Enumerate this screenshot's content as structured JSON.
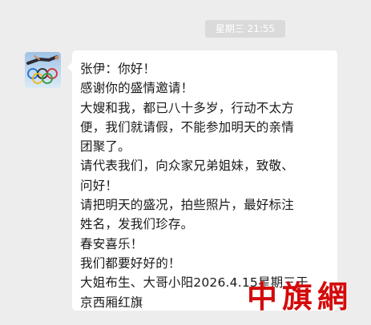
{
  "chat": {
    "timestamp": "星期三 21:55",
    "avatar_icon": "athlete-diving-over-olympic-rings-icon",
    "message": {
      "lines": [
        "张伊：你好！",
        "感谢你的盛情邀请！",
        "大嫂和我，都已八十多岁，行动不太方",
        "便，我们就请假，不能参加明天的亲情",
        "团聚了。",
        "请代表我们，向众家兄弟姐妹，致敬、",
        "问好！",
        "请把明天的盛况，拍些照片，最好标注",
        "姓名，发我们珍存。",
        "春安喜乐！",
        "我们都要好好的！",
        "大姐布生、大哥小阳2026.4.15星期三于",
        "京西厢红旗"
      ]
    }
  },
  "watermark": {
    "text": "中旗網",
    "color": "#d40b0b"
  },
  "colors": {
    "background": "#ededed",
    "bubble": "#ffffff",
    "timestamp_badge": "#dadada"
  }
}
